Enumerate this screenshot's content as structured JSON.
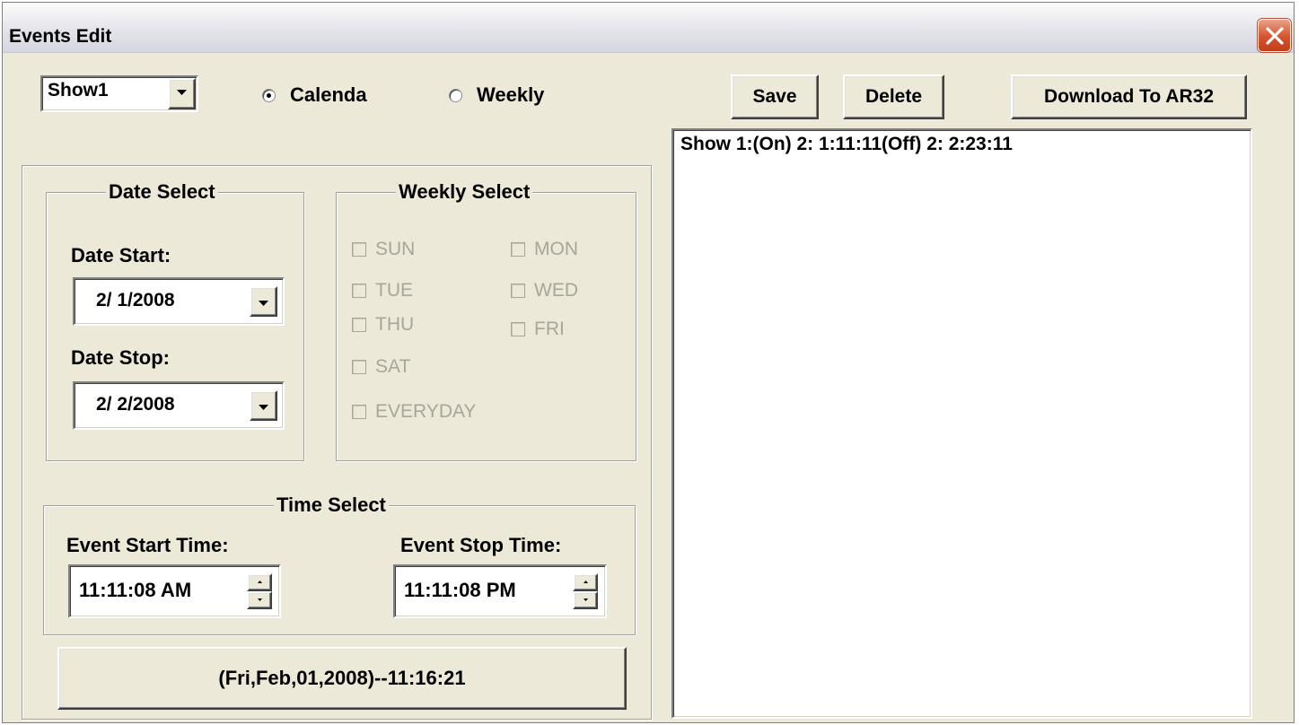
{
  "window": {
    "title": "Events Edit"
  },
  "show_select": {
    "value": "Show1"
  },
  "mode": {
    "calenda_label": "Calenda",
    "weekly_label": "Weekly",
    "selected": "Calenda"
  },
  "toolbar": {
    "save_label": "Save",
    "delete_label": "Delete",
    "download_label": "Download To AR32"
  },
  "date_select": {
    "title": "Date Select",
    "start_label": "Date Start:",
    "start_value": "2/ 1/2008",
    "stop_label": "Date Stop:",
    "stop_value": "2/ 2/2008"
  },
  "weekly_select": {
    "title": "Weekly Select",
    "days": {
      "sun": "SUN",
      "mon": "MON",
      "tue": "TUE",
      "wed": "WED",
      "thu": "THU",
      "fri": "FRI",
      "sat": "SAT",
      "everyday": "EVERYDAY"
    }
  },
  "time_select": {
    "title": "Time Select",
    "start_label": "Event Start Time:",
    "start_value": "11:11:08 AM",
    "stop_label": "Event Stop Time:",
    "stop_value": "11:11:08 PM"
  },
  "status": {
    "text": "(Fri,Feb,01,2008)--11:16:21"
  },
  "events_list": {
    "items": [
      "Show 1:(On) 2: 1:11:11(Off) 2: 2:23:11"
    ]
  },
  "colors": {
    "face": "#ECE9D8",
    "disabled_text": "#A8A69A",
    "close_red": "#D5532F"
  }
}
